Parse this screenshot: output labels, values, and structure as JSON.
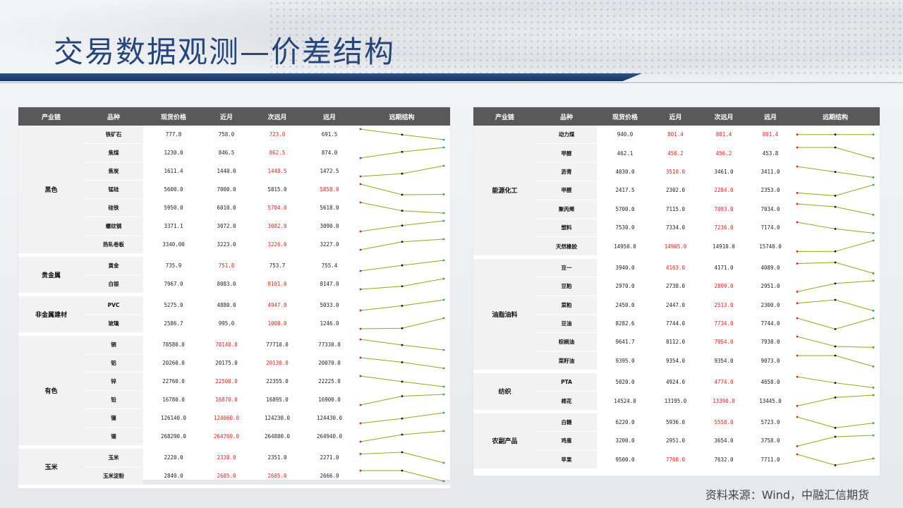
{
  "title": "交易数据观测—价差结构",
  "source": "资料来源：Wind，中融汇信期货",
  "colors": {
    "title": "#26467a",
    "header_bg": "#595959",
    "highlight": "#e0211b",
    "spark_line": "#9aa515"
  },
  "columns": [
    "产业链",
    "品种",
    "现货价格",
    "近月",
    "次远月",
    "远月",
    "远期结构"
  ],
  "left_groups": [
    {
      "chain": "黑色",
      "rows": [
        {
          "name": "铁矿石",
          "spot": "777.8",
          "near": "758.0",
          "mid": "723.0",
          "far": "691.5",
          "hl": "mid"
        },
        {
          "name": "焦煤",
          "spot": "1230.0",
          "near": "846.5",
          "mid": "862.5",
          "far": "874.0",
          "hl": "mid"
        },
        {
          "name": "焦炭",
          "spot": "1611.4",
          "near": "1440.0",
          "mid": "1448.5",
          "far": "1472.5",
          "hl": "mid"
        },
        {
          "name": "锰硅",
          "spot": "5600.0",
          "near": "7000.0",
          "mid": "5815.0",
          "far": "5858.0",
          "hl": "far"
        },
        {
          "name": "硅铁",
          "spot": "5950.0",
          "near": "6010.0",
          "mid": "5704.0",
          "far": "5618.0",
          "hl": "mid"
        },
        {
          "name": "螺纹钢",
          "spot": "3371.1",
          "near": "3072.0",
          "mid": "3082.0",
          "far": "3090.0",
          "hl": "mid"
        },
        {
          "name": "热轧卷板",
          "spot": "3340.00",
          "near": "3223.0",
          "mid": "3226.0",
          "far": "3227.0",
          "hl": "mid"
        }
      ]
    },
    {
      "chain": "贵金属",
      "rows": [
        {
          "name": "黄金",
          "spot": "735.9",
          "near": "751.8",
          "mid": "753.7",
          "far": "755.4",
          "hl": "near"
        },
        {
          "name": "白银",
          "spot": "7967.0",
          "near": "8083.0",
          "mid": "8101.0",
          "far": "8147.0",
          "hl": "mid"
        }
      ]
    },
    {
      "chain": "非金属建材",
      "rows": [
        {
          "name": "PVC",
          "spot": "5275.0",
          "near": "4880.0",
          "mid": "4947.0",
          "far": "5033.0",
          "hl": "mid"
        },
        {
          "name": "玻璃",
          "spot": "2586.7",
          "near": "995.0",
          "mid": "1008.0",
          "far": "1246.0",
          "hl": "mid"
        }
      ]
    },
    {
      "chain": "有色",
      "rows": [
        {
          "name": "铜",
          "spot": "78580.0",
          "near": "78140.0",
          "mid": "77710.0",
          "far": "77330.0",
          "hl": "near"
        },
        {
          "name": "铝",
          "spot": "20260.0",
          "near": "20175.0",
          "mid": "20130.0",
          "far": "20070.0",
          "hl": "mid"
        },
        {
          "name": "锌",
          "spot": "22760.0",
          "near": "22500.0",
          "mid": "22355.0",
          "far": "22225.0",
          "hl": "near"
        },
        {
          "name": "铅",
          "spot": "16780.0",
          "near": "16870.0",
          "mid": "16895.0",
          "far": "16900.0",
          "hl": "near"
        },
        {
          "name": "镍",
          "spot": "126140.0",
          "near": "124060.0",
          "mid": "124230.0",
          "far": "124430.0",
          "hl": "near"
        },
        {
          "name": "锡",
          "spot": "268290.0",
          "near": "264760.0",
          "mid": "264880.0",
          "far": "264940.0",
          "hl": "near"
        }
      ]
    },
    {
      "chain": "玉米",
      "rows": [
        {
          "name": "玉米",
          "spot": "2220.0",
          "near": "2338.0",
          "mid": "2351.0",
          "far": "2271.0",
          "hl": "near"
        },
        {
          "name": "玉米淀粉",
          "spot": "2840.0",
          "near": "2685.0",
          "mid": "2685.0",
          "far": "2666.0",
          "hl": "both"
        }
      ]
    }
  ],
  "right_groups": [
    {
      "chain": "能源化工",
      "rows": [
        {
          "name": "动力煤",
          "spot": "940.0",
          "near": "801.4",
          "mid": "801.4",
          "far": "801.4",
          "hl": "all"
        },
        {
          "name": "甲醇",
          "spot": "462.1",
          "near": "456.2",
          "mid": "456.2",
          "far": "453.8",
          "hl": "both"
        },
        {
          "name": "沥青",
          "spot": "4030.0",
          "near": "3510.0",
          "mid": "3461.0",
          "far": "3411.0",
          "hl": "near"
        },
        {
          "name": "甲醛",
          "spot": "2417.5",
          "near": "2302.0",
          "mid": "2284.0",
          "far": "2353.0",
          "hl": "mid"
        },
        {
          "name": "聚丙烯",
          "spot": "5700.0",
          "near": "7115.0",
          "mid": "7093.0",
          "far": "7034.0",
          "hl": "mid"
        },
        {
          "name": "塑料",
          "spot": "7530.0",
          "near": "7334.0",
          "mid": "7236.0",
          "far": "7174.0",
          "hl": "mid"
        },
        {
          "name": "天然橡胶",
          "spot": "14950.0",
          "near": "14905.0",
          "mid": "14910.0",
          "far": "15740.0",
          "hl": "near"
        }
      ]
    },
    {
      "chain": "油脂油料",
      "rows": [
        {
          "name": "豆一",
          "spot": "3940.0",
          "near": "4163.0",
          "mid": "4171.0",
          "far": "4089.0",
          "hl": "near"
        },
        {
          "name": "豆粕",
          "spot": "2970.0",
          "near": "2738.0",
          "mid": "2899.0",
          "far": "2951.0",
          "hl": "mid"
        },
        {
          "name": "菜粕",
          "spot": "2450.0",
          "near": "2447.0",
          "mid": "2513.0",
          "far": "2300.0",
          "hl": "mid"
        },
        {
          "name": "豆油",
          "spot": "8282.6",
          "near": "7744.0",
          "mid": "7734.0",
          "far": "7744.0",
          "hl": "mid"
        },
        {
          "name": "棕榈油",
          "spot": "9641.7",
          "near": "8112.0",
          "mid": "7954.0",
          "far": "7938.0",
          "hl": "mid"
        },
        {
          "name": "菜籽油",
          "spot": "9395.0",
          "near": "9354.0",
          "mid": "9354.0",
          "far": "9073.0",
          "hl": ""
        }
      ]
    },
    {
      "chain": "纺织",
      "rows": [
        {
          "name": "PTA",
          "spot": "5020.0",
          "near": "4924.0",
          "mid": "4774.0",
          "far": "4658.0",
          "hl": "mid"
        },
        {
          "name": "棉花",
          "spot": "14524.0",
          "near": "13195.0",
          "mid": "13390.0",
          "far": "13445.0",
          "hl": "mid"
        }
      ]
    },
    {
      "chain": "农副产品",
      "rows": [
        {
          "name": "白糖",
          "spot": "6220.0",
          "near": "5936.0",
          "mid": "5558.0",
          "far": "5723.0",
          "hl": "mid"
        },
        {
          "name": "鸡蛋",
          "spot": "3200.0",
          "near": "2951.0",
          "mid": "3654.0",
          "far": "3758.0",
          "hl": ""
        },
        {
          "name": "苹果",
          "spot": "9500.0",
          "near": "7760.0",
          "mid": "7632.0",
          "far": "7711.0",
          "hl": "near"
        }
      ]
    }
  ]
}
